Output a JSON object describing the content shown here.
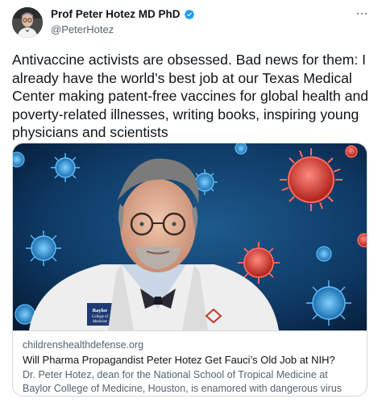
{
  "author": {
    "display_name": "Prof Peter Hotez MD PhD",
    "handle": "@PeterHotez",
    "verified": true,
    "verified_icon": "verified-badge-icon",
    "verified_color": "#1d9bf0"
  },
  "tweet": {
    "text": "Antivaccine activists are obsessed. Bad news for them: I already have the world’s best job at our Texas Medical Center making patent-free vaccines for global health and poverty-related illnesses, writing books, inspiring young physicians and scientists"
  },
  "card": {
    "domain": "childrenshealthdefense.org",
    "title": "Will Pharma Propagandist Peter Hotez Get Fauci’s Old Job at NIH?",
    "description": "Dr. Peter Hotez, dean for the National School of Tropical Medicine at Baylor College of Medicine, Houston, is enamored with dangerous virus tinkering, …",
    "image": {
      "badge_lines": [
        "Baylor",
        "College of",
        "Medicine"
      ]
    }
  },
  "icons": {
    "more": "more-options-icon"
  },
  "colors": {
    "text_primary": "#0f1419",
    "text_secondary": "#536471",
    "border": "#cfd9de"
  }
}
